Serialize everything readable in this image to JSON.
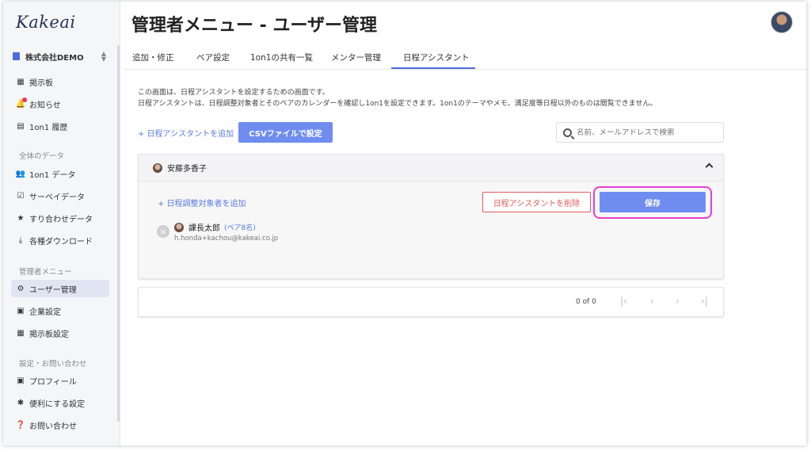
{
  "app": {
    "logo": "Kakeai"
  },
  "sidebar": {
    "company": "株式会社DEMO",
    "items_top": [
      {
        "label": "掲示板"
      },
      {
        "label": "お知らせ"
      },
      {
        "label": "1on1 履歴"
      }
    ],
    "section_data": "全体のデータ",
    "items_data": [
      {
        "label": "1on1 データ"
      },
      {
        "label": "サーベイデータ"
      },
      {
        "label": "すり合わせデータ"
      },
      {
        "label": "各種ダウンロード"
      }
    ],
    "section_admin": "管理者メニュー",
    "items_admin": [
      {
        "label": "ユーザー管理"
      },
      {
        "label": "企業設定"
      },
      {
        "label": "掲示板設定"
      }
    ],
    "section_settings": "設定・お問い合わせ",
    "items_settings": [
      {
        "label": "プロフィール"
      },
      {
        "label": "便利にする設定"
      },
      {
        "label": "お問い合わせ"
      }
    ]
  },
  "header": {
    "title": "管理者メニュー - ユーザー管理"
  },
  "tabs": [
    {
      "label": "追加・修正"
    },
    {
      "label": "ペア設定"
    },
    {
      "label": "1on1の共有一覧"
    },
    {
      "label": "メンター管理"
    },
    {
      "label": "日程アシスタント"
    }
  ],
  "description": {
    "line1": "この画面は、日程アシスタントを設定するための画面です。",
    "line2": "日程アシスタントは、日程調整対象者とそのペアのカレンダーを確認し1on1を設定できます。1on1のテーマやメモ、満足度等日程以外のものは閲覧できません。"
  },
  "toolbar": {
    "add_assistant": "+ 日程アシスタントを追加",
    "csv_button": "CSVファイルで設定",
    "search_placeholder": "名前、メールアドレスで検索"
  },
  "panel": {
    "assistant_name": "安藤多香子",
    "add_target": "+ 日程調整対象者を追加",
    "delete_button": "日程アシスタントを削除",
    "save_button": "保存",
    "remove_icon": "×",
    "target": {
      "name": "課長太郎",
      "pair": "(ペア8名)",
      "email": "h.honda+kachou@kakeai.co.jp"
    }
  },
  "pagination": {
    "count": "0 of 0",
    "first": "|‹",
    "prev": "‹",
    "next": "›",
    "last": "›|"
  },
  "colors": {
    "accent": "#6f8df0",
    "danger": "#e05b5b",
    "highlight": "#e83ed4"
  }
}
